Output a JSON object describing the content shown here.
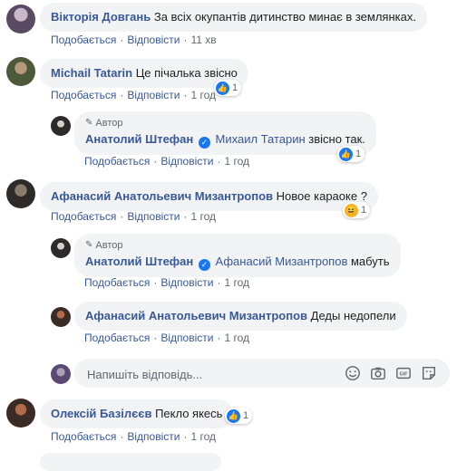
{
  "comments": [
    {
      "author": "Вікторія Довгань",
      "text": "За всіх окупантів дитинство минає в землянках.",
      "time": "11 хв"
    },
    {
      "author": "Michail Tatarin",
      "text": "Це пічалька звісно",
      "time": "1 год",
      "reactions": "1"
    },
    {
      "badge": "Автор",
      "author": "Анатолий Штефан",
      "mention": "Михаил Татарин",
      "text": "звісно так.",
      "time": "1 год",
      "reactions": "1"
    },
    {
      "author": "Афанасий Анатольевич Мизантропов",
      "text": "Новое караоке ?",
      "time": "1 год",
      "reactions": "1"
    },
    {
      "badge": "Автор",
      "author": "Анатолий Штефан",
      "mention": "Афанасий Мизантропов",
      "text": "мабуть",
      "time": "1 год"
    },
    {
      "author": "Афанасий Анатольевич Мизантропов",
      "text": "Деды недопели",
      "time": "1 год"
    },
    {
      "author": "Олексій Базілєєв",
      "text": "Пекло якесь",
      "time": "1 год",
      "reactions": "1"
    }
  ],
  "actions": {
    "like": "Подобається",
    "reply": "Відповісти",
    "dot": "·"
  },
  "reply_box": {
    "placeholder": "Напишіть відповідь..."
  },
  "icons": {
    "pen": "pen-icon",
    "verified": "verified-check-icon",
    "like": "like-reaction-icon",
    "haha": "haha-reaction-icon",
    "emoji": "emoji-icon",
    "camera": "camera-icon",
    "gif": "gif-icon",
    "sticker": "sticker-icon"
  },
  "colors": {
    "link": "#385898",
    "bubble": "#f2f3f5",
    "like_blue": "#1877f2",
    "haha_yellow": "#f7b125"
  }
}
